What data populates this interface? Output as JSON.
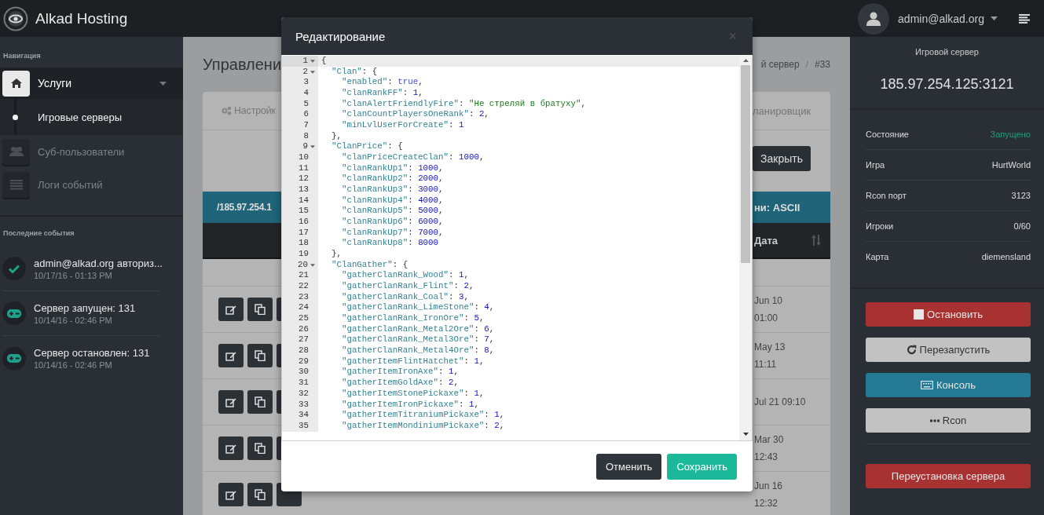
{
  "header": {
    "brand": "Alkad Hosting",
    "user": "admin@alkad.org"
  },
  "sidebar": {
    "nav_heading": "Навигация",
    "items": [
      {
        "label": "Услуги",
        "kind": "home",
        "selected": true,
        "expanded": true,
        "children": [
          {
            "label": "Игровые серверы",
            "selected": true
          }
        ]
      },
      {
        "label": "Суб-пользователи",
        "kind": "users",
        "selected": false
      },
      {
        "label": "Логи событий",
        "kind": "list",
        "selected": false
      }
    ],
    "events_heading": "Последние события",
    "events": [
      {
        "kind": "check",
        "text": "admin@alkad.org авториз...",
        "time": "10/17/16 - 01:13 PM"
      },
      {
        "kind": "gamepad",
        "text": "Сервер запущен: 131",
        "time": "10/14/16 - 02:46 PM"
      },
      {
        "kind": "gamepad",
        "text": "Сервер остановлен: 131",
        "time": "10/14/16 - 02:46 PM"
      }
    ]
  },
  "main": {
    "title": "Управлени",
    "breadcrumb": [
      {
        "kind": "link",
        "text": "й сервер"
      },
      {
        "kind": "separator",
        "text": "/"
      },
      {
        "kind": "current",
        "text": "#33"
      }
    ],
    "tabs": [
      {
        "label": "Настройк",
        "selected": false
      },
      {
        "label": "ланировщик",
        "selected": false
      }
    ],
    "close_button": "Закрыть",
    "path_bar": {
      "left": "/185.97.254.1",
      "right": "ни: ASCII"
    },
    "table": {
      "column_header": "Дата",
      "rows": [
        {
          "date": [
            "Jun 10",
            "01:00"
          ]
        },
        {
          "date": [
            "May 13",
            "11:11"
          ]
        },
        {
          "date": [
            "Jul 21 09:10"
          ]
        },
        {
          "date": [
            "Mar 30",
            "12:43"
          ]
        },
        {
          "date": [
            "Jun 16",
            "12:32"
          ]
        }
      ]
    }
  },
  "server_panel": {
    "title": "Игровой сервер",
    "address": "185.97.254.125:3121",
    "info": [
      {
        "label": "Состояние",
        "value": "Запущено",
        "kind": "status"
      },
      {
        "label": "Игра",
        "value": "HurtWorld",
        "kind": "plain"
      },
      {
        "label": "Rcon порт",
        "value": "3123",
        "kind": "plain"
      },
      {
        "label": "Игроки",
        "value": "0/60",
        "kind": "plain"
      },
      {
        "label": "Карта",
        "value": "diemensland",
        "kind": "plain"
      }
    ],
    "actions": [
      {
        "label": "Остановить",
        "kind": "stop"
      },
      {
        "label": "Перезапустить",
        "kind": "restart"
      },
      {
        "label": "Консоль",
        "kind": "console"
      },
      {
        "label": "Rcon",
        "kind": "rcon"
      }
    ],
    "reinstall_button": "Переустановка сервера"
  },
  "modal": {
    "title": "Редактирование",
    "close": "×",
    "cancel": "Отменить",
    "save": "Сохранить",
    "lines": [
      {
        "number": "1",
        "foldable": true,
        "active": true,
        "tokens": [
          {
            "kind": "punct",
            "text": "{"
          }
        ]
      },
      {
        "number": "2",
        "foldable": true,
        "active": false,
        "tokens": [
          {
            "kind": "key",
            "text": "  \"Clan\""
          },
          {
            "kind": "punct",
            "text": ": {"
          }
        ]
      },
      {
        "number": "3",
        "foldable": false,
        "active": false,
        "tokens": [
          {
            "kind": "key",
            "text": "    \"enabled\""
          },
          {
            "kind": "punct",
            "text": ": "
          },
          {
            "kind": "bool",
            "text": "true"
          },
          {
            "kind": "punct",
            "text": ","
          }
        ]
      },
      {
        "number": "4",
        "foldable": false,
        "active": false,
        "tokens": [
          {
            "kind": "key",
            "text": "    \"clanRankFF\""
          },
          {
            "kind": "punct",
            "text": ": "
          },
          {
            "kind": "number",
            "text": "1"
          },
          {
            "kind": "punct",
            "text": ","
          }
        ]
      },
      {
        "number": "5",
        "foldable": false,
        "active": false,
        "tokens": [
          {
            "kind": "key",
            "text": "    \"clanAlertFriendlyFire\""
          },
          {
            "kind": "punct",
            "text": ": "
          },
          {
            "kind": "string",
            "text": "\"Не стреляй в братуху\""
          },
          {
            "kind": "punct",
            "text": ","
          }
        ]
      },
      {
        "number": "6",
        "foldable": false,
        "active": false,
        "tokens": [
          {
            "kind": "key",
            "text": "    \"clanCountPlayersOneRank\""
          },
          {
            "kind": "punct",
            "text": ": "
          },
          {
            "kind": "number",
            "text": "2"
          },
          {
            "kind": "punct",
            "text": ","
          }
        ]
      },
      {
        "number": "7",
        "foldable": false,
        "active": false,
        "tokens": [
          {
            "kind": "key",
            "text": "    \"minLvlUserForCreate\""
          },
          {
            "kind": "punct",
            "text": ": "
          },
          {
            "kind": "number",
            "text": "1"
          }
        ]
      },
      {
        "number": "8",
        "foldable": false,
        "active": false,
        "tokens": [
          {
            "kind": "punct",
            "text": "  },"
          }
        ]
      },
      {
        "number": "9",
        "foldable": true,
        "active": false,
        "tokens": [
          {
            "kind": "key",
            "text": "  \"ClanPrice\""
          },
          {
            "kind": "punct",
            "text": ": {"
          }
        ]
      },
      {
        "number": "10",
        "foldable": false,
        "active": false,
        "tokens": [
          {
            "kind": "key",
            "text": "    \"clanPriceCreateClan\""
          },
          {
            "kind": "punct",
            "text": ": "
          },
          {
            "kind": "number",
            "text": "1000"
          },
          {
            "kind": "punct",
            "text": ","
          }
        ]
      },
      {
        "number": "11",
        "foldable": false,
        "active": false,
        "tokens": [
          {
            "kind": "key",
            "text": "    \"clanRankUp1\""
          },
          {
            "kind": "punct",
            "text": ": "
          },
          {
            "kind": "number",
            "text": "1000"
          },
          {
            "kind": "punct",
            "text": ","
          }
        ]
      },
      {
        "number": "12",
        "foldable": false,
        "active": false,
        "tokens": [
          {
            "kind": "key",
            "text": "    \"clanRankUp2\""
          },
          {
            "kind": "punct",
            "text": ": "
          },
          {
            "kind": "number",
            "text": "2000"
          },
          {
            "kind": "punct",
            "text": ","
          }
        ]
      },
      {
        "number": "13",
        "foldable": false,
        "active": false,
        "tokens": [
          {
            "kind": "key",
            "text": "    \"clanRankUp3\""
          },
          {
            "kind": "punct",
            "text": ": "
          },
          {
            "kind": "number",
            "text": "3000"
          },
          {
            "kind": "punct",
            "text": ","
          }
        ]
      },
      {
        "number": "14",
        "foldable": false,
        "active": false,
        "tokens": [
          {
            "kind": "key",
            "text": "    \"clanRankUp4\""
          },
          {
            "kind": "punct",
            "text": ": "
          },
          {
            "kind": "number",
            "text": "4000"
          },
          {
            "kind": "punct",
            "text": ","
          }
        ]
      },
      {
        "number": "15",
        "foldable": false,
        "active": false,
        "tokens": [
          {
            "kind": "key",
            "text": "    \"clanRankUp5\""
          },
          {
            "kind": "punct",
            "text": ": "
          },
          {
            "kind": "number",
            "text": "5000"
          },
          {
            "kind": "punct",
            "text": ","
          }
        ]
      },
      {
        "number": "16",
        "foldable": false,
        "active": false,
        "tokens": [
          {
            "kind": "key",
            "text": "    \"clanRankUp6\""
          },
          {
            "kind": "punct",
            "text": ": "
          },
          {
            "kind": "number",
            "text": "6000"
          },
          {
            "kind": "punct",
            "text": ","
          }
        ]
      },
      {
        "number": "17",
        "foldable": false,
        "active": false,
        "tokens": [
          {
            "kind": "key",
            "text": "    \"clanRankUp7\""
          },
          {
            "kind": "punct",
            "text": ": "
          },
          {
            "kind": "number",
            "text": "7000"
          },
          {
            "kind": "punct",
            "text": ","
          }
        ]
      },
      {
        "number": "18",
        "foldable": false,
        "active": false,
        "tokens": [
          {
            "kind": "key",
            "text": "    \"clanRankUp8\""
          },
          {
            "kind": "punct",
            "text": ": "
          },
          {
            "kind": "number",
            "text": "8000"
          }
        ]
      },
      {
        "number": "19",
        "foldable": false,
        "active": false,
        "tokens": [
          {
            "kind": "punct",
            "text": "  },"
          }
        ]
      },
      {
        "number": "20",
        "foldable": true,
        "active": false,
        "tokens": [
          {
            "kind": "key",
            "text": "  \"ClanGather\""
          },
          {
            "kind": "punct",
            "text": ": {"
          }
        ]
      },
      {
        "number": "21",
        "foldable": false,
        "active": false,
        "tokens": [
          {
            "kind": "key",
            "text": "    \"gatherClanRank_Wood\""
          },
          {
            "kind": "punct",
            "text": ": "
          },
          {
            "kind": "number",
            "text": "1"
          },
          {
            "kind": "punct",
            "text": ","
          }
        ]
      },
      {
        "number": "22",
        "foldable": false,
        "active": false,
        "tokens": [
          {
            "kind": "key",
            "text": "    \"gatherClanRank_Flint\""
          },
          {
            "kind": "punct",
            "text": ": "
          },
          {
            "kind": "number",
            "text": "2"
          },
          {
            "kind": "punct",
            "text": ","
          }
        ]
      },
      {
        "number": "23",
        "foldable": false,
        "active": false,
        "tokens": [
          {
            "kind": "key",
            "text": "    \"gatherClanRank_Coal\""
          },
          {
            "kind": "punct",
            "text": ": "
          },
          {
            "kind": "number",
            "text": "3"
          },
          {
            "kind": "punct",
            "text": ","
          }
        ]
      },
      {
        "number": "24",
        "foldable": false,
        "active": false,
        "tokens": [
          {
            "kind": "key",
            "text": "    \"gatherClanRank_LimeStone\""
          },
          {
            "kind": "punct",
            "text": ": "
          },
          {
            "kind": "number",
            "text": "4"
          },
          {
            "kind": "punct",
            "text": ","
          }
        ]
      },
      {
        "number": "25",
        "foldable": false,
        "active": false,
        "tokens": [
          {
            "kind": "key",
            "text": "    \"gatherClanRank_IronOre\""
          },
          {
            "kind": "punct",
            "text": ": "
          },
          {
            "kind": "number",
            "text": "5"
          },
          {
            "kind": "punct",
            "text": ","
          }
        ]
      },
      {
        "number": "26",
        "foldable": false,
        "active": false,
        "tokens": [
          {
            "kind": "key",
            "text": "    \"gatherClanRank_Metal2Ore\""
          },
          {
            "kind": "punct",
            "text": ": "
          },
          {
            "kind": "number",
            "text": "6"
          },
          {
            "kind": "punct",
            "text": ","
          }
        ]
      },
      {
        "number": "27",
        "foldable": false,
        "active": false,
        "tokens": [
          {
            "kind": "key",
            "text": "    \"gatherClanRank_Metal3Ore\""
          },
          {
            "kind": "punct",
            "text": ": "
          },
          {
            "kind": "number",
            "text": "7"
          },
          {
            "kind": "punct",
            "text": ","
          }
        ]
      },
      {
        "number": "28",
        "foldable": false,
        "active": false,
        "tokens": [
          {
            "kind": "key",
            "text": "    \"gatherClanRank_Metal4Ore\""
          },
          {
            "kind": "punct",
            "text": ": "
          },
          {
            "kind": "number",
            "text": "8"
          },
          {
            "kind": "punct",
            "text": ","
          }
        ]
      },
      {
        "number": "29",
        "foldable": false,
        "active": false,
        "tokens": [
          {
            "kind": "key",
            "text": "    \"gatherItemFlintHatchet\""
          },
          {
            "kind": "punct",
            "text": ": "
          },
          {
            "kind": "number",
            "text": "1"
          },
          {
            "kind": "punct",
            "text": ","
          }
        ]
      },
      {
        "number": "30",
        "foldable": false,
        "active": false,
        "tokens": [
          {
            "kind": "key",
            "text": "    \"gatherItemIronAxe\""
          },
          {
            "kind": "punct",
            "text": ": "
          },
          {
            "kind": "number",
            "text": "1"
          },
          {
            "kind": "punct",
            "text": ","
          }
        ]
      },
      {
        "number": "31",
        "foldable": false,
        "active": false,
        "tokens": [
          {
            "kind": "key",
            "text": "    \"gatherItemGoldAxe\""
          },
          {
            "kind": "punct",
            "text": ": "
          },
          {
            "kind": "number",
            "text": "2"
          },
          {
            "kind": "punct",
            "text": ","
          }
        ]
      },
      {
        "number": "32",
        "foldable": false,
        "active": false,
        "tokens": [
          {
            "kind": "key",
            "text": "    \"gatherItemStonePickaxe\""
          },
          {
            "kind": "punct",
            "text": ": "
          },
          {
            "kind": "number",
            "text": "1"
          },
          {
            "kind": "punct",
            "text": ","
          }
        ]
      },
      {
        "number": "33",
        "foldable": false,
        "active": false,
        "tokens": [
          {
            "kind": "key",
            "text": "    \"gatherItemIronPickaxe\""
          },
          {
            "kind": "punct",
            "text": ": "
          },
          {
            "kind": "number",
            "text": "1"
          },
          {
            "kind": "punct",
            "text": ","
          }
        ]
      },
      {
        "number": "34",
        "foldable": false,
        "active": false,
        "tokens": [
          {
            "kind": "key",
            "text": "    \"gatherItemTitraniumPickaxe\""
          },
          {
            "kind": "punct",
            "text": ": "
          },
          {
            "kind": "number",
            "text": "1"
          },
          {
            "kind": "punct",
            "text": ","
          }
        ]
      },
      {
        "number": "35",
        "foldable": false,
        "active": false,
        "tokens": [
          {
            "kind": "key",
            "text": "    \"gatherItemMondiniumPickaxe\""
          },
          {
            "kind": "punct",
            "text": ": "
          },
          {
            "kind": "number",
            "text": "2"
          },
          {
            "kind": "punct",
            "text": ","
          }
        ]
      }
    ]
  }
}
